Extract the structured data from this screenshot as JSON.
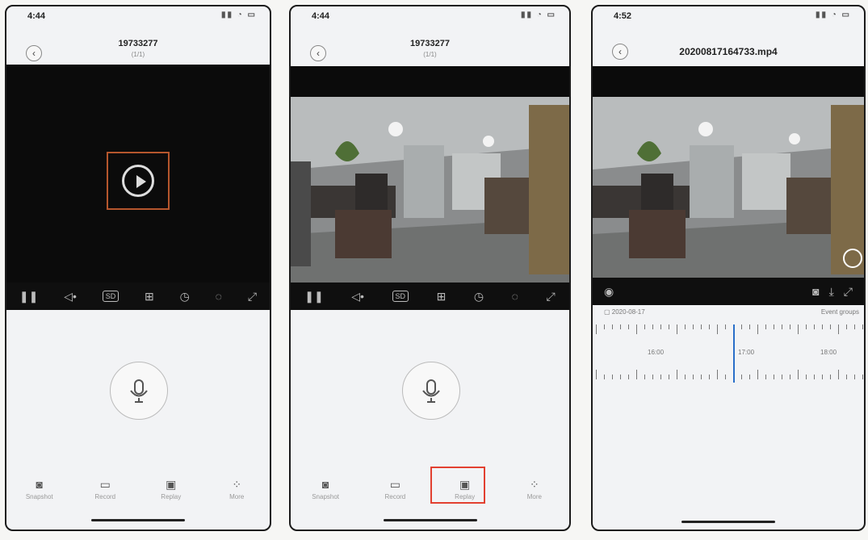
{
  "phone1": {
    "time": "4:44",
    "device_id": "19733277",
    "subtitle": "(1/1)",
    "nav": [
      "Snapshot",
      "Record",
      "Replay",
      "More"
    ]
  },
  "phone2": {
    "time": "4:44",
    "device_id": "19733277",
    "subtitle": "(1/1)",
    "nav": [
      "Snapshot",
      "Record",
      "Replay",
      "More"
    ]
  },
  "phone3": {
    "time": "4:52",
    "filename": "20200817164733.mp4",
    "date": "2020-08-17",
    "event_groups": "Event groups",
    "timeline_labels": [
      "16:00",
      "17:00",
      "18:00"
    ]
  },
  "controls": {
    "sd_label": "SD"
  },
  "icons": {
    "back": "chevron-left-icon",
    "play": "play-icon",
    "mic": "microphone-icon",
    "snapshot": "camera-icon",
    "record": "video-record-icon",
    "replay": "replay-icon",
    "more": "grid-icon"
  },
  "colors": {
    "highlight_orange": "#b5562d",
    "highlight_red": "#e24030",
    "timeline_cursor": "#2a6fc9"
  }
}
